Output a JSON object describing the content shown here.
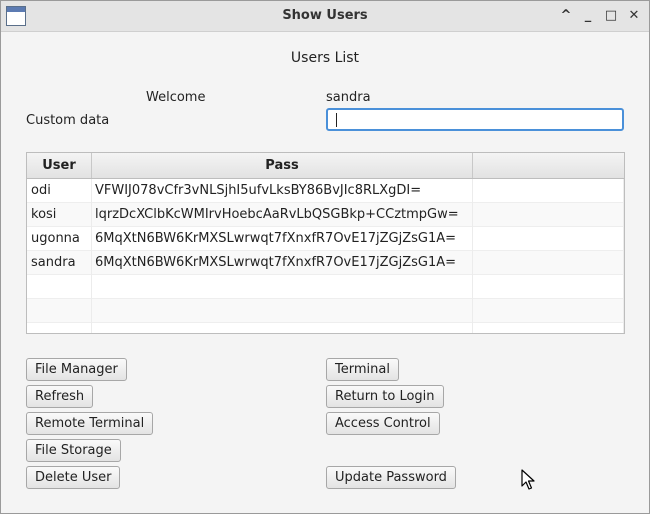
{
  "window": {
    "title": "Show Users"
  },
  "titlebar": {
    "min_glyph": "^",
    "minimize_glyph": "_",
    "maximize_glyph": "□",
    "close_glyph": "✕"
  },
  "main": {
    "heading": "Users List",
    "welcome_label": "Welcome",
    "username": "sandra",
    "custom_data_label": "Custom data",
    "custom_data_value": ""
  },
  "table": {
    "columns": [
      "User",
      "Pass",
      ""
    ],
    "rows": [
      {
        "user": "odi",
        "pass": "VFWIJ078vCfr3vNLSjhI5ufvLksBY86BvJIc8RLXgDI="
      },
      {
        "user": "kosi",
        "pass": "lqrzDcXClbKcWMIrvHoebcAaRvLbQSGBkp+CCztmpGw="
      },
      {
        "user": "ugonna",
        "pass": "6MqXtN6BW6KrMXSLwrwqt7fXnxfR7OvE17jZGjZsG1A="
      },
      {
        "user": "sandra",
        "pass": "6MqXtN6BW6KrMXSLwrwqt7fXnxfR7OvE17jZGjZsG1A="
      },
      {
        "user": "",
        "pass": ""
      },
      {
        "user": "",
        "pass": ""
      },
      {
        "user": "",
        "pass": ""
      }
    ]
  },
  "buttons": {
    "file_manager": "File Manager",
    "refresh": "Refresh",
    "remote_terminal": "Remote Terminal",
    "file_storage": "File Storage",
    "delete_user": "Delete User",
    "terminal": "Terminal",
    "return_to_login": "Return to Login",
    "access_control": "Access Control",
    "update_password": "Update Password"
  },
  "colors": {
    "focus": "#4a90d9",
    "window_bg": "#f4f4f4"
  }
}
